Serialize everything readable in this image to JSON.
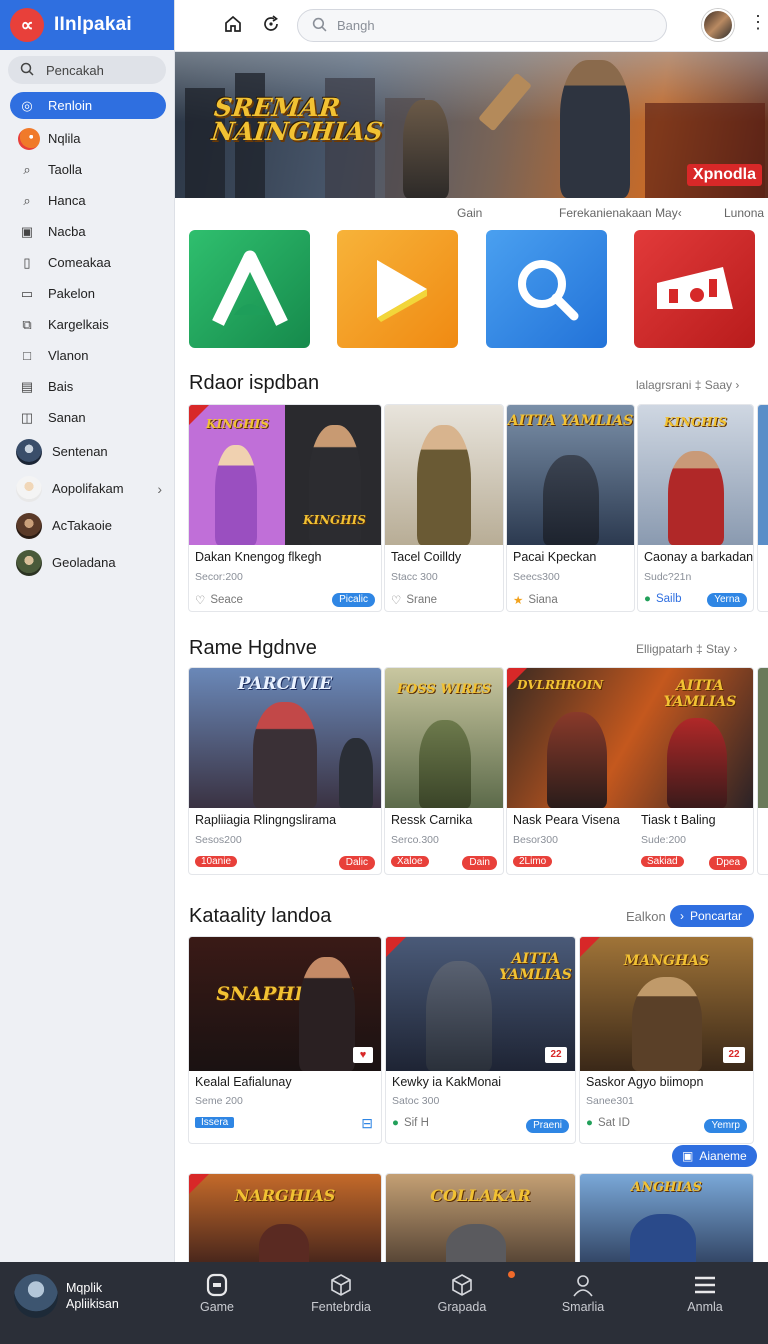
{
  "brand": {
    "title": "IInlpakai",
    "logo": "∝"
  },
  "sidebar": {
    "search_label": "Pencakah",
    "items": [
      {
        "label": "Renloin",
        "icon": "circle-icon",
        "active": true
      },
      {
        "label": "Nqlila",
        "icon": "avatar-icon"
      },
      {
        "label": "Taolla",
        "icon": "search-icon"
      },
      {
        "label": "Hanca",
        "icon": "search-icon"
      },
      {
        "label": "Nacba",
        "icon": "image-icon"
      },
      {
        "label": "Comeakaa",
        "icon": "file-icon"
      },
      {
        "label": "Pakelon",
        "icon": "folder-icon"
      },
      {
        "label": "Kargelkais",
        "icon": "copy-icon"
      },
      {
        "label": "Vlanon",
        "icon": "square-icon"
      },
      {
        "label": "Bais",
        "icon": "doc-icon"
      },
      {
        "label": "Sanan",
        "icon": "photo-icon"
      },
      {
        "label": "Sentenan",
        "icon": "avatar-icon"
      },
      {
        "label": "Aopolifakam",
        "icon": "avatar-icon"
      },
      {
        "label": "AcTakaoie",
        "icon": "avatar-icon"
      },
      {
        "label": "Geoladana",
        "icon": "avatar-icon"
      }
    ]
  },
  "header": {
    "search_placeholder": "Bangh"
  },
  "hero": {
    "title_line1": "SREMAR",
    "title_line2": "NAINGHIAS",
    "badge": "Xpnodla",
    "tabs": [
      "Gain",
      "Ferekanienakaan May‹",
      "Lunona"
    ]
  },
  "apps": [
    {
      "name": "a-app-icon",
      "color": "#1e9e5a"
    },
    {
      "name": "play-app-icon",
      "color": "#f29a1c"
    },
    {
      "name": "search-app-icon",
      "color": "#2f86e4"
    },
    {
      "name": "media-app-icon",
      "color": "#d62828"
    }
  ],
  "section1": {
    "title": "Rdaor ispdban",
    "link": "lalagrsrani ‡ Saay ›",
    "cards": [
      {
        "name": "Dakan Knengog flkegh",
        "sub": "Secor:200",
        "meta": "Seace",
        "pill": "Picalic",
        "pill_color": "#2f86e4",
        "art": "KINGHIS"
      },
      {
        "name": "Tacel Coilldy",
        "sub": "Stacc 300",
        "meta": "Srane",
        "pill": ""
      },
      {
        "name": "Pacai Kpeckan",
        "sub": "Seecs300",
        "meta": "Siana",
        "pill": "",
        "art": "AITTA YAMLIAS"
      },
      {
        "name": "Caonay a barkadan",
        "sub": "Sudc?21n",
        "meta": "Sailb",
        "pill": "Yerna",
        "pill_color": "#2f86e4",
        "art": "KINGHIS"
      }
    ]
  },
  "section2": {
    "title": "Rame Hgdnve",
    "link": "Elligpatarh ‡ Stay ›",
    "cards": [
      {
        "name": "Rapliiagia Rlingngslirama",
        "sub": "Sesos200",
        "meta": "10anie",
        "pill": "Dalic",
        "pill_color": "#e8403a",
        "art": "PARCIVIE"
      },
      {
        "name": "Ressk Carnika",
        "sub": "Serco.300",
        "meta": "Xaloe",
        "pill": "Dain",
        "pill_color": "#e8403a",
        "art": "FOSS WIRES"
      },
      {
        "name": "Nask Peara Visena",
        "sub": "Besor300",
        "meta": "2Limo",
        "pill": "",
        "art": "DVLRHROIN"
      },
      {
        "name": "Tiask t Baling",
        "sub": "Sude:200",
        "meta": "Sakiad",
        "pill": "Dpea",
        "pill_color": "#e8403a",
        "art": "AITTA YAMLIAS"
      }
    ]
  },
  "section3": {
    "title": "Kataality landoa",
    "link": "Ealkon",
    "button": "Poncartar",
    "cards": [
      {
        "name": "Kealal Eafialunay",
        "sub": "Seme 200",
        "meta": "Issera",
        "pill": "",
        "art": "SNAPHEADS"
      },
      {
        "name": "Kewky ia KakMonai",
        "sub": "Satoc 300",
        "meta": "Sif H",
        "pill": "Praeni",
        "pill_color": "#2f86e4",
        "art": "AITTA YAMLIAS"
      },
      {
        "name": "Saskor Agyo biimopn",
        "sub": "Sanee301",
        "meta": "Sat ID",
        "pill": "Yemrp",
        "pill_color": "#2f86e4",
        "art": "MANGHAS"
      }
    ],
    "more_button": "Aianeme"
  },
  "section4": {
    "cards": [
      {
        "art": "NARGHIAS"
      },
      {
        "art": "COLLAKAR"
      },
      {
        "art": "ANGHIAS"
      }
    ]
  },
  "bottombar": {
    "user_line1": "Mqplik",
    "user_line2": "Apliikisan",
    "items": [
      {
        "label": "Game",
        "icon": "controller-icon"
      },
      {
        "label": "Fentebrdia",
        "icon": "cube-icon"
      },
      {
        "label": "Grapada",
        "icon": "cube-icon"
      },
      {
        "label": "Smarlia",
        "icon": "user-icon"
      },
      {
        "label": "Anmla",
        "icon": "menu-icon"
      }
    ]
  },
  "colors": {
    "accent": "#2f6fe0",
    "brand_red": "#e8403a",
    "bottombar": "#2b2f38"
  }
}
